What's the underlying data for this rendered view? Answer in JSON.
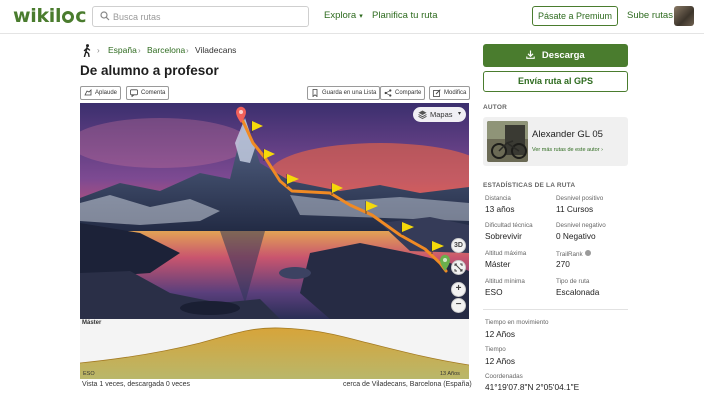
{
  "header": {
    "logo": "wikiloc",
    "search_placeholder": "Busca rutas",
    "nav_explora": "Explora",
    "nav_planifica": "Planifica tu ruta",
    "premium_button": "Pásate a Premium",
    "sube_rutas": "Sube rutas"
  },
  "breadcrumb": {
    "items": [
      "España",
      "Barcelona",
      "Viladecans"
    ]
  },
  "title": "De alumno a profesor",
  "actions": {
    "aplaude": "Aplaude",
    "comenta": "Comenta",
    "guardar": "Guarda en una Lista",
    "compartir": "Comparte",
    "modificar": "Modifica"
  },
  "map": {
    "layers_button": "Mapas",
    "btn_3d": "3D",
    "zoom_in": "+",
    "zoom_out": "−"
  },
  "elevation": {
    "label": "Máster",
    "start": "ESO",
    "end": "13 Años"
  },
  "footer": {
    "views": "Vista 1 veces, descargada 0 veces",
    "location": "cerca de Viladecans, Barcelona (España)"
  },
  "sidebar": {
    "download_button": "Descarga",
    "gps_button": "Envía ruta al GPS",
    "author_heading": "AUTOR",
    "author_name": "Alexander GL 05",
    "author_link": "Ver más rutas de este autor ›",
    "stats_heading": "ESTADÍSTICAS DE LA RUTA",
    "stats": [
      {
        "label": "Distancia",
        "value": "13 años"
      },
      {
        "label": "Desnivel positivo",
        "value": "11 Cursos"
      },
      {
        "label": "Dificultad técnica",
        "value": "Sobrevivir"
      },
      {
        "label": "Desnivel negativo",
        "value": "0 Negativo"
      },
      {
        "label": "Altitud máxima",
        "value": "Máster"
      },
      {
        "label": "TrailRank",
        "value": "270"
      },
      {
        "label": "Altitud mínima",
        "value": "ESO"
      },
      {
        "label": "Tipo de ruta",
        "value": "Escalonada"
      }
    ],
    "time_moving_label": "Tiempo en movimiento",
    "time_moving_value": "12 Años",
    "time_label": "Tiempo",
    "time_value": "12 Años",
    "coords_label": "Coordenadas",
    "coords_value": "41°19'07.8\"N 2°05'04.1\"E"
  },
  "colors": {
    "brand": "#4a7c2e",
    "route": "#f08a24",
    "flag": "#f5d90a"
  }
}
